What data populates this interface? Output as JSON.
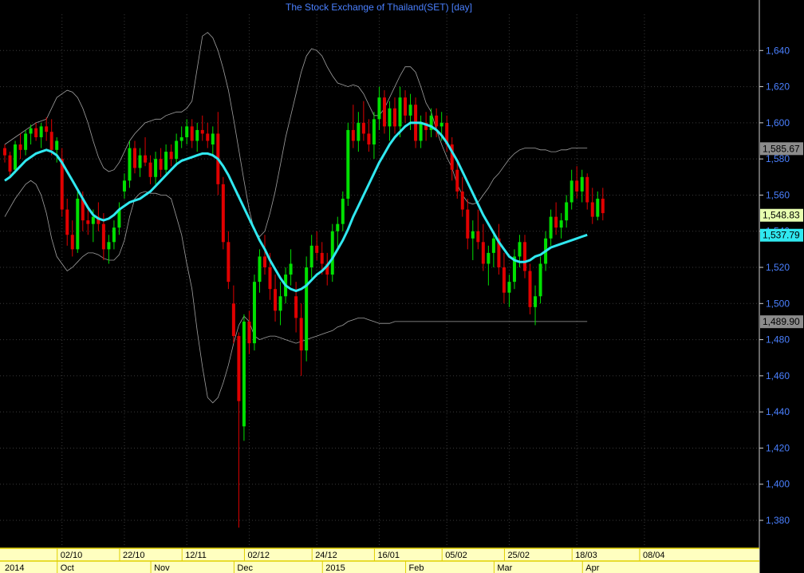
{
  "chart_data": {
    "type": "candlestick",
    "title": "The Stock Exchange of Thailand(SET) [day]",
    "ylim": [
      1365,
      1660
    ],
    "yticks": [
      "1,380",
      "1,400",
      "1,420",
      "1,440",
      "1,460",
      "1,480",
      "1,500",
      "1,520",
      "1,540",
      "1,560",
      "1,580",
      "1,600",
      "1,620",
      "1,640"
    ],
    "ytick_values": [
      1380,
      1400,
      1420,
      1440,
      1460,
      1480,
      1500,
      1520,
      1540,
      1560,
      1580,
      1600,
      1620,
      1640
    ],
    "x_day_labels": [
      {
        "label": "02/10",
        "index": 11
      },
      {
        "label": "22/10",
        "index": 23
      },
      {
        "label": "12/11",
        "index": 35
      },
      {
        "label": "02/12",
        "index": 47
      },
      {
        "label": "24/12",
        "index": 60
      },
      {
        "label": "16/01",
        "index": 72
      },
      {
        "label": "05/02",
        "index": 85
      },
      {
        "label": "25/02",
        "index": 97
      },
      {
        "label": "18/03",
        "index": 110
      },
      {
        "label": "08/04",
        "index": 123
      }
    ],
    "x_month_labels": [
      {
        "label": "2014",
        "index": 0
      },
      {
        "label": "Oct",
        "index": 11
      },
      {
        "label": "Nov",
        "index": 29
      },
      {
        "label": "Dec",
        "index": 45
      },
      {
        "label": "2015",
        "index": 62
      },
      {
        "label": "Feb",
        "index": 78
      },
      {
        "label": "Mar",
        "index": 95
      },
      {
        "label": "Apr",
        "index": 112
      }
    ],
    "series": [
      {
        "name": "price",
        "color_up": "#00e000",
        "color_down": "#e00000",
        "candles": [
          [
            1586,
            1588,
            1578,
            1582
          ],
          [
            1582,
            1584,
            1570,
            1573
          ],
          [
            1574,
            1590,
            1572,
            1588
          ],
          [
            1588,
            1594,
            1580,
            1585
          ],
          [
            1585,
            1596,
            1582,
            1594
          ],
          [
            1594,
            1599,
            1588,
            1597
          ],
          [
            1597,
            1600,
            1590,
            1592
          ],
          [
            1592,
            1600,
            1586,
            1598
          ],
          [
            1598,
            1603,
            1590,
            1595
          ],
          [
            1595,
            1602,
            1582,
            1585
          ],
          [
            1585,
            1592,
            1578,
            1590
          ],
          [
            1580,
            1586,
            1548,
            1552
          ],
          [
            1552,
            1558,
            1532,
            1538
          ],
          [
            1538,
            1546,
            1526,
            1530
          ],
          [
            1530,
            1562,
            1528,
            1558
          ],
          [
            1558,
            1562,
            1540,
            1546
          ],
          [
            1546,
            1552,
            1538,
            1544
          ],
          [
            1544,
            1552,
            1534,
            1548
          ],
          [
            1548,
            1556,
            1540,
            1544
          ],
          [
            1544,
            1550,
            1524,
            1530
          ],
          [
            1530,
            1538,
            1522,
            1534
          ],
          [
            1534,
            1546,
            1530,
            1542
          ],
          [
            1542,
            1556,
            1538,
            1552
          ],
          [
            1562,
            1572,
            1558,
            1568
          ],
          [
            1568,
            1590,
            1564,
            1586
          ],
          [
            1586,
            1590,
            1572,
            1575
          ],
          [
            1575,
            1586,
            1570,
            1582
          ],
          [
            1582,
            1592,
            1576,
            1578
          ],
          [
            1578,
            1582,
            1566,
            1570
          ],
          [
            1570,
            1584,
            1566,
            1580
          ],
          [
            1580,
            1586,
            1570,
            1574
          ],
          [
            1574,
            1588,
            1572,
            1584
          ],
          [
            1584,
            1588,
            1576,
            1580
          ],
          [
            1580,
            1594,
            1576,
            1590
          ],
          [
            1590,
            1598,
            1586,
            1592
          ],
          [
            1592,
            1602,
            1588,
            1598
          ],
          [
            1598,
            1602,
            1586,
            1590
          ],
          [
            1590,
            1600,
            1584,
            1596
          ],
          [
            1596,
            1604,
            1590,
            1594
          ],
          [
            1594,
            1600,
            1586,
            1590
          ],
          [
            1588,
            1598,
            1582,
            1594
          ],
          [
            1594,
            1606,
            1560,
            1566
          ],
          [
            1566,
            1570,
            1530,
            1534
          ],
          [
            1534,
            1540,
            1508,
            1512
          ],
          [
            1500,
            1510,
            1478,
            1482
          ],
          [
            1482,
            1484,
            1376,
            1446
          ],
          [
            1432,
            1494,
            1424,
            1490
          ],
          [
            1490,
            1496,
            1472,
            1478
          ],
          [
            1478,
            1516,
            1474,
            1512
          ],
          [
            1512,
            1530,
            1506,
            1526
          ],
          [
            1526,
            1538,
            1516,
            1520
          ],
          [
            1520,
            1528,
            1502,
            1508
          ],
          [
            1508,
            1516,
            1490,
            1496
          ],
          [
            1496,
            1512,
            1488,
            1504
          ],
          [
            1504,
            1520,
            1500,
            1516
          ],
          [
            1516,
            1530,
            1510,
            1522
          ],
          [
            1504,
            1512,
            1484,
            1492
          ],
          [
            1492,
            1500,
            1460,
            1474
          ],
          [
            1474,
            1526,
            1468,
            1520
          ],
          [
            1520,
            1538,
            1514,
            1532
          ],
          [
            1532,
            1540,
            1524,
            1528
          ],
          [
            1528,
            1534,
            1516,
            1522
          ],
          [
            1522,
            1528,
            1510,
            1516
          ],
          [
            1516,
            1544,
            1512,
            1540
          ],
          [
            1540,
            1548,
            1530,
            1544
          ],
          [
            1544,
            1562,
            1540,
            1558
          ],
          [
            1558,
            1600,
            1554,
            1596
          ],
          [
            1596,
            1610,
            1586,
            1590
          ],
          [
            1590,
            1606,
            1584,
            1600
          ],
          [
            1600,
            1612,
            1590,
            1594
          ],
          [
            1594,
            1602,
            1584,
            1588
          ],
          [
            1588,
            1606,
            1580,
            1602
          ],
          [
            1602,
            1620,
            1596,
            1614
          ],
          [
            1614,
            1618,
            1594,
            1598
          ],
          [
            1598,
            1612,
            1590,
            1608
          ],
          [
            1608,
            1614,
            1594,
            1598
          ],
          [
            1598,
            1620,
            1592,
            1614
          ],
          [
            1614,
            1618,
            1600,
            1604
          ],
          [
            1604,
            1616,
            1596,
            1610
          ],
          [
            1610,
            1614,
            1586,
            1590
          ],
          [
            1590,
            1604,
            1586,
            1600
          ],
          [
            1600,
            1606,
            1590,
            1596
          ],
          [
            1596,
            1608,
            1592,
            1604
          ],
          [
            1604,
            1608,
            1592,
            1598
          ],
          [
            1598,
            1606,
            1590,
            1600
          ],
          [
            1600,
            1604,
            1584,
            1588
          ],
          [
            1588,
            1592,
            1568,
            1574
          ],
          [
            1574,
            1580,
            1558,
            1562
          ],
          [
            1562,
            1570,
            1548,
            1552
          ],
          [
            1552,
            1558,
            1530,
            1536
          ],
          [
            1536,
            1546,
            1524,
            1540
          ],
          [
            1540,
            1552,
            1530,
            1534
          ],
          [
            1534,
            1544,
            1518,
            1522
          ],
          [
            1522,
            1532,
            1510,
            1528
          ],
          [
            1528,
            1540,
            1520,
            1536
          ],
          [
            1536,
            1544,
            1516,
            1520
          ],
          [
            1520,
            1528,
            1500,
            1506
          ],
          [
            1506,
            1516,
            1498,
            1512
          ],
          [
            1512,
            1530,
            1508,
            1526
          ],
          [
            1526,
            1538,
            1520,
            1534
          ],
          [
            1534,
            1538,
            1514,
            1518
          ],
          [
            1518,
            1522,
            1494,
            1498
          ],
          [
            1498,
            1510,
            1488,
            1504
          ],
          [
            1504,
            1526,
            1500,
            1522
          ],
          [
            1522,
            1540,
            1518,
            1536
          ],
          [
            1536,
            1552,
            1532,
            1548
          ],
          [
            1548,
            1556,
            1538,
            1542
          ],
          [
            1542,
            1550,
            1536,
            1546
          ],
          [
            1546,
            1560,
            1542,
            1556
          ],
          [
            1556,
            1574,
            1552,
            1568
          ],
          [
            1568,
            1576,
            1558,
            1562
          ],
          [
            1562,
            1574,
            1556,
            1570
          ],
          [
            1570,
            1572,
            1552,
            1556
          ],
          [
            1556,
            1564,
            1544,
            1548
          ],
          [
            1548,
            1562,
            1546,
            1558
          ],
          [
            1558,
            1564,
            1546,
            1550
          ]
        ]
      },
      {
        "name": "ma",
        "color": "#30e8f0",
        "values": [
          1568,
          1570,
          1573,
          1576,
          1579,
          1581,
          1583,
          1584,
          1585,
          1584,
          1582,
          1578,
          1573,
          1568,
          1563,
          1558,
          1553,
          1549,
          1547,
          1546,
          1547,
          1549,
          1552,
          1554,
          1556,
          1557,
          1558,
          1560,
          1562,
          1565,
          1568,
          1571,
          1574,
          1577,
          1579,
          1580,
          1581,
          1582,
          1583,
          1583,
          1582,
          1580,
          1576,
          1571,
          1565,
          1559,
          1553,
          1547,
          1541,
          1535,
          1530,
          1524,
          1519,
          1514,
          1510,
          1508,
          1507,
          1508,
          1510,
          1513,
          1516,
          1518,
          1521,
          1525,
          1530,
          1535,
          1541,
          1548,
          1554,
          1560,
          1566,
          1572,
          1578,
          1583,
          1588,
          1592,
          1595,
          1598,
          1600,
          1600,
          1600,
          1599,
          1598,
          1596,
          1593,
          1589,
          1584,
          1579,
          1573,
          1567,
          1561,
          1555,
          1549,
          1544,
          1539,
          1534,
          1530,
          1526,
          1524,
          1523,
          1523,
          1524,
          1526,
          1527,
          1529,
          1531,
          1532,
          1533,
          1534,
          1535,
          1536,
          1537,
          1538
        ]
      },
      {
        "name": "upper",
        "color": "#a0a0a0",
        "values": [
          1588,
          1590,
          1592,
          1594,
          1596,
          1598,
          1600,
          1601,
          1602,
          1608,
          1614,
          1616,
          1618,
          1617,
          1614,
          1608,
          1600,
          1590,
          1581,
          1575,
          1573,
          1574,
          1578,
          1584,
          1590,
          1594,
          1597,
          1600,
          1601,
          1602,
          1602,
          1604,
          1605,
          1606,
          1606,
          1608,
          1612,
          1630,
          1648,
          1650,
          1647,
          1640,
          1630,
          1618,
          1602,
          1585,
          1568,
          1552,
          1540,
          1537,
          1540,
          1550,
          1562,
          1577,
          1592,
          1604,
          1616,
          1628,
          1637,
          1641,
          1640,
          1637,
          1631,
          1626,
          1622,
          1621,
          1620,
          1621,
          1620,
          1616,
          1610,
          1604,
          1604,
          1608,
          1614,
          1620,
          1626,
          1631,
          1631,
          1628,
          1620,
          1611,
          1606,
          1596,
          1588,
          1581,
          1575,
          1566,
          1560,
          1556,
          1555,
          1556,
          1560,
          1564,
          1569,
          1572,
          1576,
          1580,
          1583,
          1585,
          1586,
          1586,
          1586,
          1585,
          1585,
          1584,
          1584,
          1585,
          1585,
          1586,
          1586,
          1586,
          1586
        ]
      },
      {
        "name": "lower",
        "color": "#a0a0a0",
        "values": [
          1548,
          1553,
          1558,
          1562,
          1566,
          1568,
          1566,
          1560,
          1550,
          1536,
          1526,
          1522,
          1518,
          1520,
          1523,
          1526,
          1528,
          1528,
          1527,
          1525,
          1524,
          1524,
          1527,
          1535,
          1548,
          1558,
          1561,
          1562,
          1561,
          1561,
          1560,
          1560,
          1558,
          1548,
          1538,
          1522,
          1508,
          1485,
          1465,
          1448,
          1445,
          1448,
          1456,
          1466,
          1478,
          1488,
          1493,
          1490,
          1482,
          1480,
          1481,
          1482,
          1482,
          1481,
          1480,
          1479,
          1478,
          1479,
          1480,
          1481,
          1482,
          1483,
          1484,
          1485,
          1487,
          1488,
          1490,
          1491,
          1492,
          1492,
          1491,
          1490,
          1489,
          1489,
          1489,
          1490,
          1490,
          1490,
          1490,
          1490,
          1490,
          1490,
          1490,
          1490,
          1490,
          1490,
          1490,
          1490,
          1490,
          1490,
          1490,
          1490,
          1490,
          1490,
          1490,
          1490,
          1490,
          1490,
          1490,
          1490,
          1490,
          1490,
          1490,
          1490,
          1490,
          1490,
          1490,
          1490,
          1490,
          1490,
          1490,
          1490,
          1490
        ]
      }
    ],
    "value_labels": [
      {
        "value": 1585.67,
        "text": "1,585.67",
        "bg": "#8c8c8c",
        "fg": "#000000"
      },
      {
        "value": 1548.83,
        "text": "1,548.83",
        "bg": "#e8ffb0",
        "fg": "#000000"
      },
      {
        "value": 1537.79,
        "text": "1,537.79",
        "bg": "#30e8f0",
        "fg": "#000000"
      },
      {
        "value": 1489.9,
        "text": "1,489.90",
        "bg": "#8c8c8c",
        "fg": "#000000"
      }
    ],
    "grid": true,
    "colors": {
      "background": "#000000",
      "axis_text": "#4a80ff",
      "grid": "#3a3a3a",
      "bottom_bar": "#ffffc0",
      "bottom_border": "#e0d000"
    }
  }
}
